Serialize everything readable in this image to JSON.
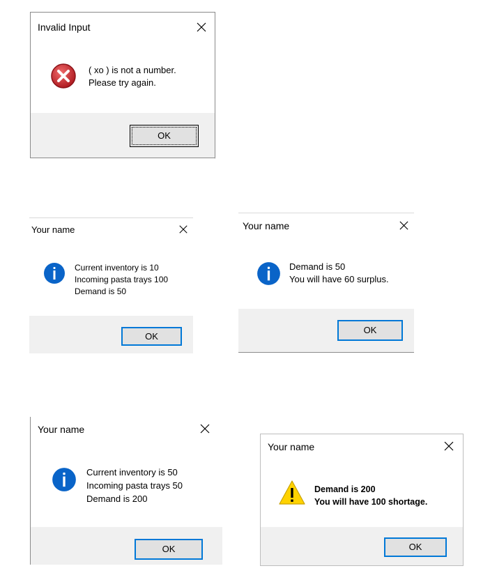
{
  "dialogs": [
    {
      "title": "Invalid Input",
      "icon": "error-icon",
      "lines": [
        "( xo ) is not a number.",
        "Please try again."
      ],
      "ok_label": "OK"
    },
    {
      "title": "Your name",
      "icon": "info-icon",
      "lines": [
        "Current inventory is 10",
        "Incoming pasta trays 100",
        "Demand is 50"
      ],
      "ok_label": "OK"
    },
    {
      "title": "Your name",
      "icon": "info-icon",
      "lines": [
        "Demand is 50",
        "You will have 60 surplus."
      ],
      "ok_label": "OK"
    },
    {
      "title": "Your name",
      "icon": "info-icon",
      "lines": [
        "Current inventory is 50",
        "Incoming pasta trays 50",
        "Demand is 200"
      ],
      "ok_label": "OK"
    },
    {
      "title": "Your name",
      "icon": "warning-icon",
      "lines": [
        "Demand is 200",
        "You will have 100 shortage."
      ],
      "ok_label": "OK"
    }
  ],
  "colors": {
    "footer_bg": "#f0f0f0",
    "button_bg": "#e1e1e1",
    "focus_blue": "#0078d7",
    "info_blue": "#0a64c8",
    "error_red": "#c8242b",
    "warning_yellow": "#ffd200"
  }
}
